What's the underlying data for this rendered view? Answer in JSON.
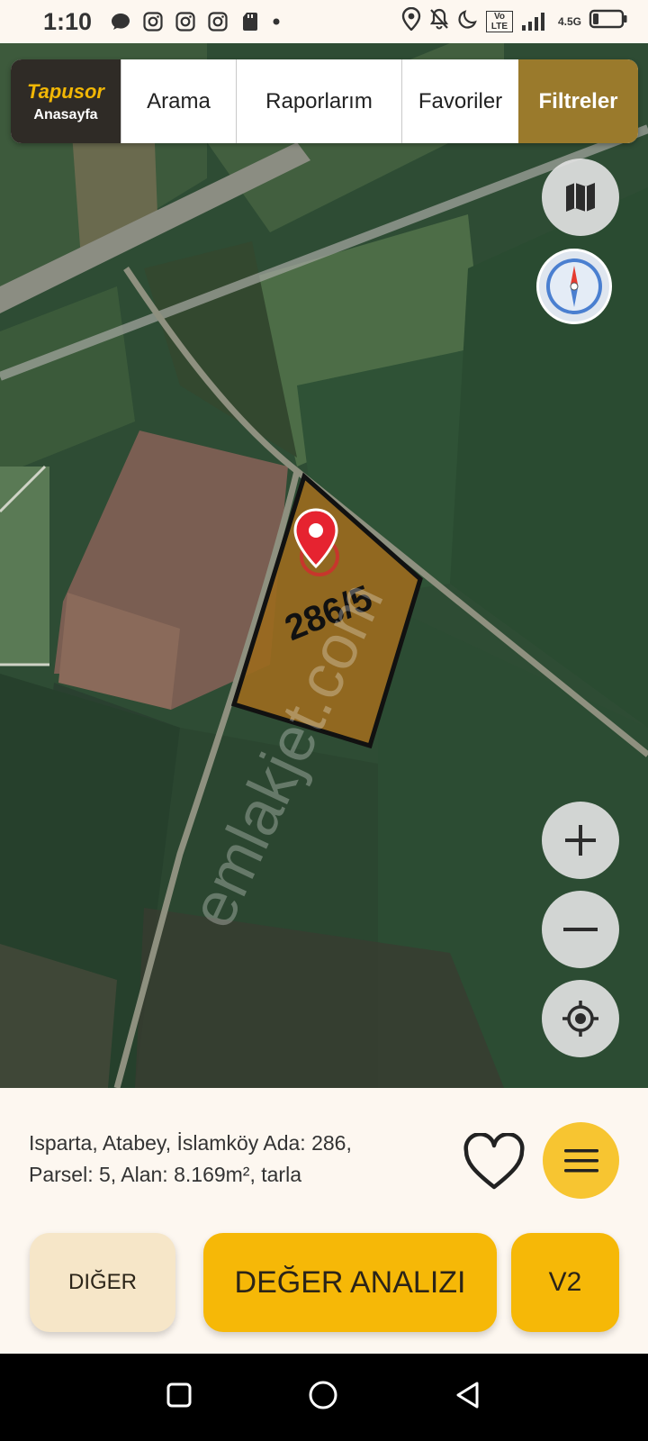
{
  "status_bar": {
    "time": "1:10",
    "network": "4.5G",
    "volte": "Vo LTE",
    "icons": [
      "chat-icon",
      "instagram-icon",
      "instagram-icon",
      "instagram-icon",
      "sdcard-icon",
      "dot-icon",
      "location-icon",
      "bell-off-icon",
      "moon-icon",
      "volte-icon",
      "signal-icon",
      "battery-icon"
    ]
  },
  "nav": {
    "brand_logo": "Tapusor",
    "brand_sub": "Anasayfa",
    "tabs": [
      "Arama",
      "Raporlarım",
      "Favoriler",
      "Filtreler"
    ],
    "active_tab": "Filtreler"
  },
  "map": {
    "parcel_label": "286/5",
    "watermark": "emlakjet.com",
    "parcel_color": "#9a6a1e",
    "controls": [
      "map-layers-icon",
      "compass-icon",
      "zoom-in-icon",
      "zoom-out-icon",
      "locate-icon"
    ]
  },
  "info": {
    "line1": "Isparta, Atabey, İslamköy Ada: 286,",
    "line2": "Parsel: 5, Alan: 8.169m², tarla"
  },
  "buttons": {
    "diger": "DIĞER",
    "deger_analizi": "DEĞER ANALIZI",
    "v2": "V2"
  },
  "colors": {
    "accent": "#f6b807",
    "brand_dark": "#2f2b26",
    "active_tab": "#9a7a2c"
  }
}
